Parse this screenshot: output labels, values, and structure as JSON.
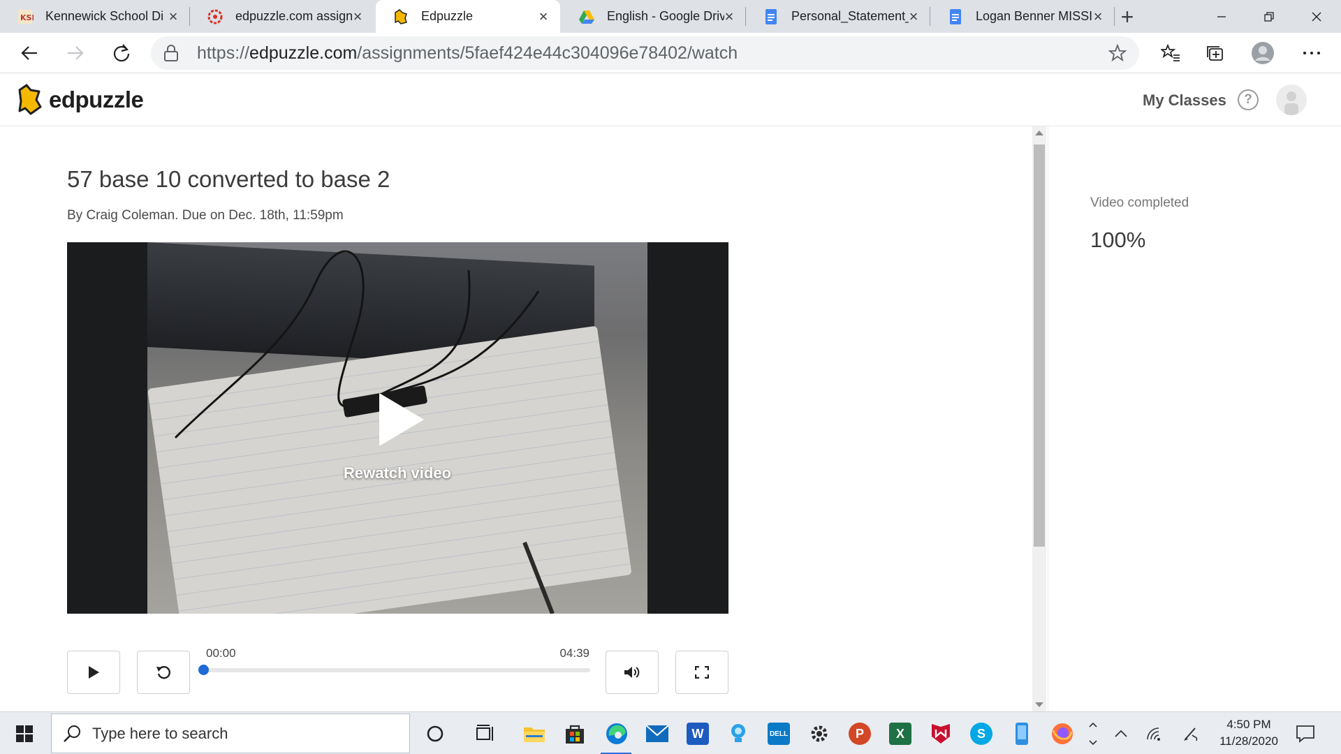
{
  "browser": {
    "tabs": [
      {
        "title": "Kennewick School Di",
        "favicon": "ksd-logo-icon"
      },
      {
        "title": "edpuzzle.com assign",
        "favicon": "red-gear-icon"
      },
      {
        "title": "Edpuzzle",
        "favicon": "edpuzzle-icon",
        "active": true
      },
      {
        "title": "English - Google Driv",
        "favicon": "google-drive-icon"
      },
      {
        "title": "Personal_Statement_",
        "favicon": "google-docs-icon"
      },
      {
        "title": "Logan Benner MISSIC",
        "favicon": "google-docs-icon"
      }
    ],
    "url_prefix": "https://",
    "url_host": "edpuzzle.com",
    "url_path": "/assignments/5faef424e44c304096e78402/watch"
  },
  "edpuzzle": {
    "logo_text": "edpuzzle",
    "nav_my_classes": "My Classes",
    "help_symbol": "?"
  },
  "assignment": {
    "title": "57 base 10 converted to base 2",
    "meta": "By Craig Coleman. Due on Dec. 18th, 11:59pm",
    "overlay_label": "Rewatch video",
    "time_current": "00:00",
    "time_total": "04:39",
    "progress_fraction": 0
  },
  "side_panel": {
    "completed_label": "Video completed",
    "completed_value": "100%"
  },
  "taskbar": {
    "search_placeholder": "Type here to search",
    "clock_time": "4:50 PM",
    "clock_date": "11/28/2020"
  },
  "colors": {
    "accent_blue": "#1e6ad7",
    "edpuzzle_yellow": "#f5b800"
  }
}
